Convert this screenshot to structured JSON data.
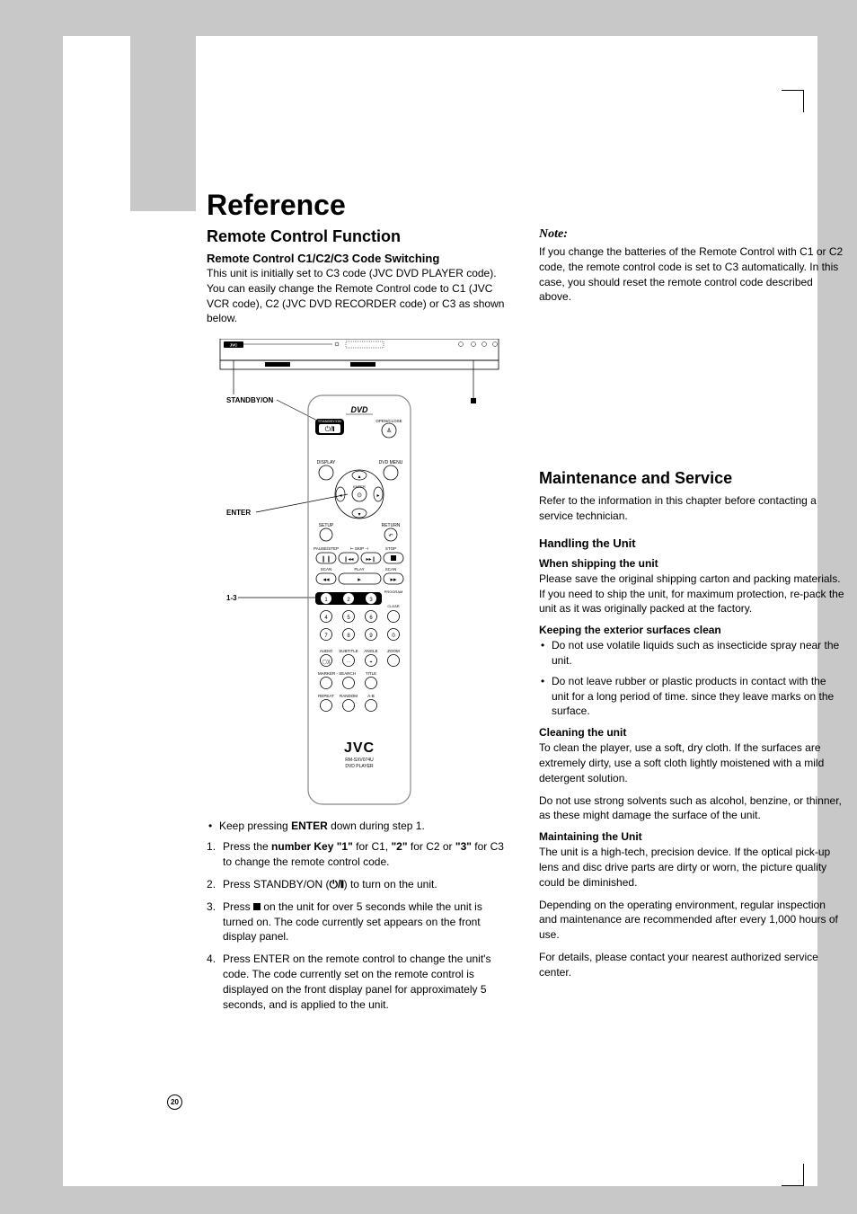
{
  "page_number": "20",
  "title": "Reference",
  "left": {
    "heading": "Remote Control Function",
    "subheading": "Remote Control C1/C2/C3 Code Switching",
    "intro": "This unit is initially set to C3 code (JVC DVD PLAYER code). You can easily change the Remote Control code to C1 (JVC VCR code), C2 (JVC DVD RECORDER code) or C3 as shown below.",
    "diagram_labels": {
      "standby": "STANDBY/ON",
      "enter": "ENTER",
      "one_three": "1-3",
      "brand": "JVC",
      "model": "RM-SXV074U",
      "device": "DVD PLAYER",
      "dvd_logo": "DVD"
    },
    "bullets": [
      {
        "pre": "Keep pressing ",
        "bold": "ENTER",
        "post": " down during step 1."
      }
    ],
    "steps": [
      {
        "pre": "Press the ",
        "bold1": "number Key \"1\"",
        "mid1": " for C1, ",
        "bold2": "\"2\"",
        "mid2": " for C2 or ",
        "bold3": "\"3\"",
        "post": " for C3 to change the remote control code."
      },
      {
        "text_pre": "Press STANDBY/ON (",
        "text_post": ") to turn on the unit."
      },
      {
        "text_pre": "Press ",
        "text_post": " on the unit for over 5 seconds while the unit is turned on. The code currently set appears on the front display panel."
      },
      {
        "text": "Press ENTER on the remote control to change the unit's code. The code currently set on the remote control is displayed on the front display panel for approximately 5 seconds, and is applied to the unit."
      }
    ]
  },
  "right": {
    "note_label": "Note:",
    "note_text": "If you change the batteries of the Remote Control with C1 or C2 code, the remote control code is set to C3 automatically. In this case, you should reset the remote control code described above.",
    "maint_heading": "Maintenance and Service",
    "maint_intro": "Refer to the information in this chapter before contacting a service technician.",
    "h_handling": "Handling the Unit",
    "h_shipping": "When shipping the unit",
    "p_shipping": "Please save the original shipping carton and packing materials. If you need to ship the unit, for maximum protection, re-pack the unit as it was originally packed at the factory.",
    "h_exterior": "Keeping the exterior surfaces clean",
    "exterior_bullets": [
      "Do not use volatile liquids such as insecticide spray near the unit.",
      "Do not leave rubber or plastic products in contact with the unit for a long period of time. since they leave marks on the surface."
    ],
    "h_cleaning": "Cleaning the unit",
    "p_cleaning1": "To clean the player, use a soft, dry cloth. If the surfaces are extremely dirty, use a soft cloth lightly moistened with a mild detergent solution.",
    "p_cleaning2": "Do not use strong solvents such as alcohol, benzine, or thinner, as these might damage the surface of the unit.",
    "h_maintaining": "Maintaining the Unit",
    "p_maintaining1": "The unit is a high-tech, precision device. If the optical pick-up lens and disc drive parts are dirty or worn, the picture quality could be diminished.",
    "p_maintaining2": "Depending on the operating environment, regular inspection and maintenance are recommended after every 1,000 hours of use.",
    "p_maintaining3": "For details, please contact your nearest authorized service center."
  }
}
